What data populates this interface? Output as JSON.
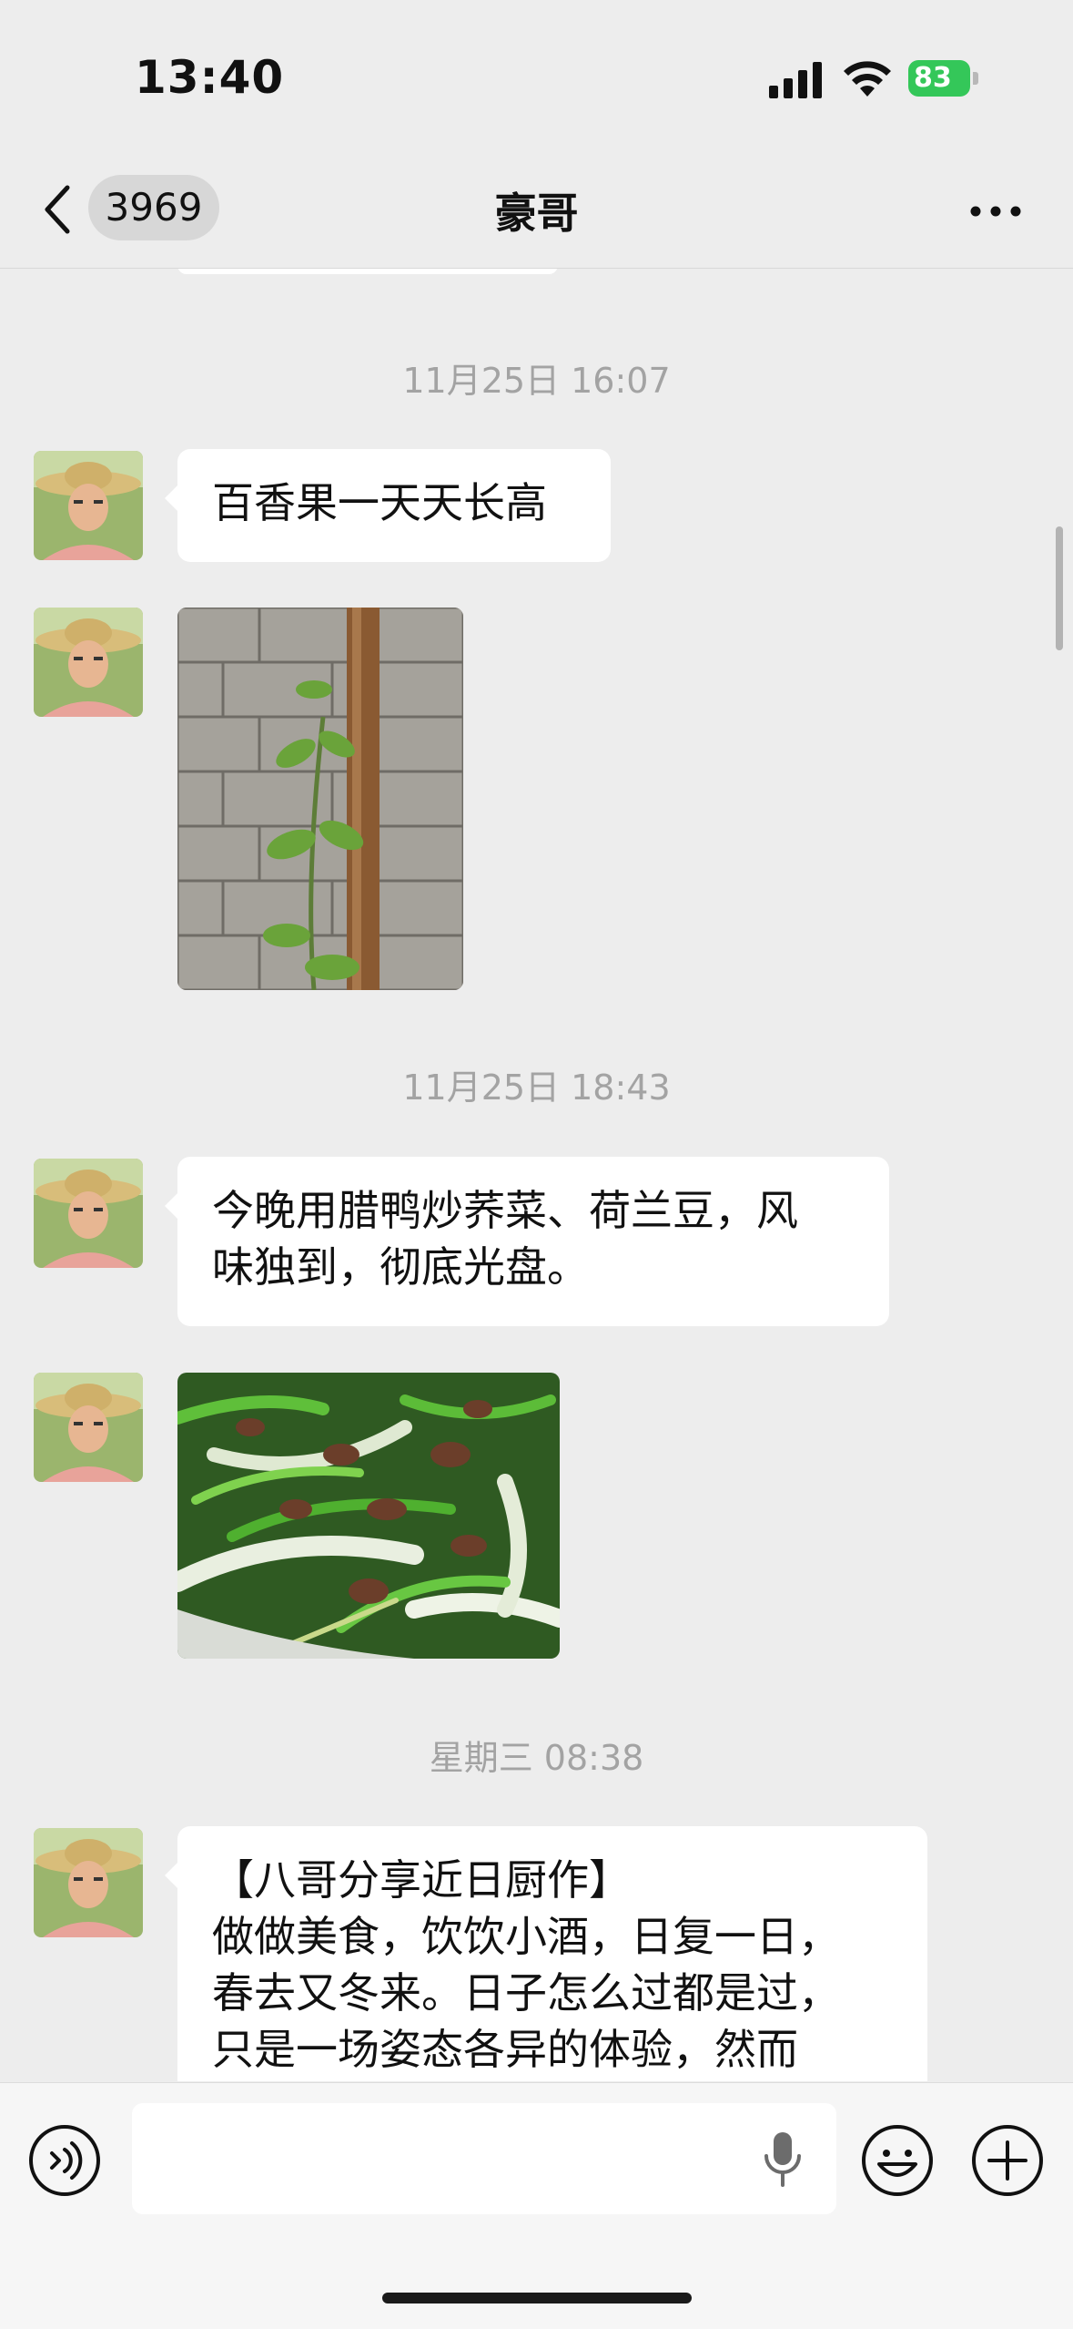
{
  "status_bar": {
    "time": "13:40",
    "battery_level": "83",
    "battery_color": "#34c759"
  },
  "nav": {
    "unread_count": "3969",
    "title": "豪哥"
  },
  "messages": [
    {
      "type": "timestamp",
      "text": "11月25日 16:07"
    },
    {
      "type": "text",
      "text": "百香果一天天长高"
    },
    {
      "type": "image",
      "alt": "passion-fruit-plant-photo"
    },
    {
      "type": "timestamp",
      "text": "11月25日 18:43"
    },
    {
      "type": "text",
      "text": "今晚用腊鸭炒荞菜、荷兰豆，风\n味独到，彻底光盘。"
    },
    {
      "type": "image",
      "alt": "stir-fry-dish-photo"
    },
    {
      "type": "timestamp",
      "text": "星期三 08:38"
    },
    {
      "type": "text",
      "text": "【八哥分享近日厨作】\n做做美食，饮饮小酒，日复一日，\n春去又冬来。日子怎么过都是过，\n只是一场姿态各异的体验，然而"
    }
  ],
  "input_bar": {
    "placeholder": ""
  },
  "colors": {
    "background": "#ededed",
    "bubble": "#ffffff",
    "timestamp": "#a3a3a3"
  }
}
